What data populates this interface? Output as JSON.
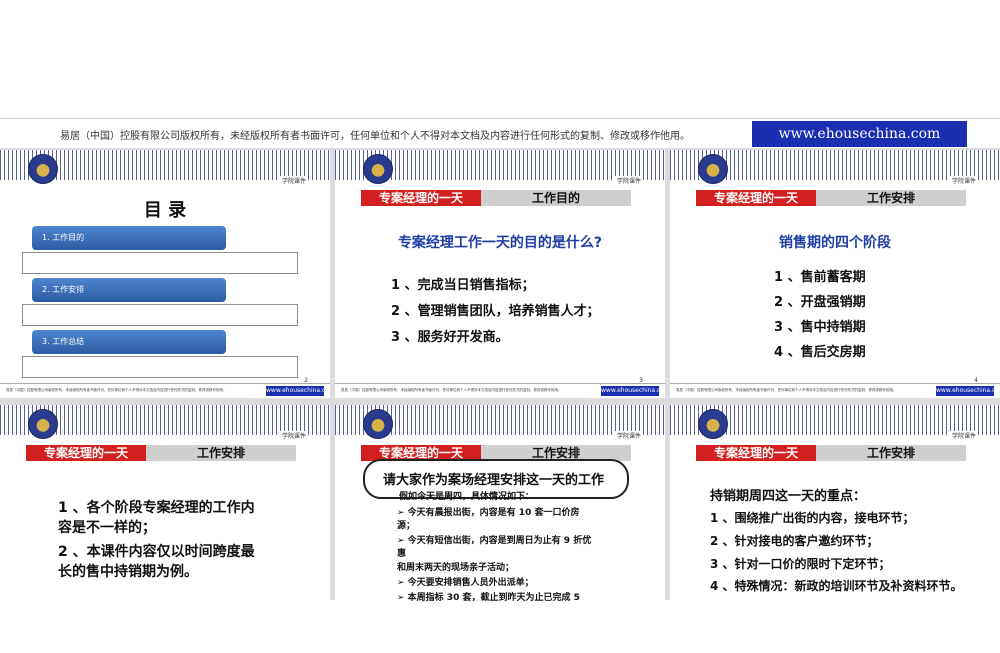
{
  "banner": {
    "text": "易居（中国）控股有限公司版权所有，未经版权所有者书面许可，任何单位和个人不得对本文档及内容进行任何形式的复制、修改或移作他用。",
    "logo": "www.ehousechina.com"
  },
  "common": {
    "course_label": "学院课件",
    "footer_text": "易居（中国）控股有限公司版权所有，未经版权所有者书面许可，任何单位和个人不得对本文档及内容进行任何形式的复制、修改或移作他用。",
    "footer_logo": "www.ehousechina.com",
    "tab_left": "专案经理的一天"
  },
  "slides": {
    "s1": {
      "title": "目 录",
      "items": [
        "1.  工作目的",
        "2.  工作安排",
        "3.  工作总结"
      ],
      "page": "2"
    },
    "s2": {
      "tab_right": "工作目的",
      "heading": "专案经理工作一天的目的是什么?",
      "lines": [
        "1 、完成当日销售指标；",
        "2 、管理销售团队，培养销售人才；",
        "3 、服务好开发商。"
      ],
      "page": "3"
    },
    "s3": {
      "tab_right": "工作安排",
      "heading": "销售期的四个阶段",
      "lines": [
        "1 、售前蓄客期",
        "2 、开盘强销期",
        "3 、售中持销期",
        "4 、售后交房期"
      ],
      "page": "4"
    },
    "s4": {
      "tab_right": "工作安排",
      "lines": [
        "1 、各个阶段专案经理的工作内",
        "容是不一样的；",
        "2 、本课件内容仅以时间跨度最",
        "长的售中持销期为例。"
      ]
    },
    "s5": {
      "tab_right": "工作安排",
      "oval": "请大家作为案场经理安排这一天的工作",
      "intro": "假如今天是周四，具体情况如下：",
      "bullets": [
        "➢   今天有晨报出街，内容是有 10 套一口价房",
        "源；",
        "➢   今天有短信出街，内容是到周日为止有 9 折优",
        "惠",
        "      和周末两天的现场亲子活动；",
        "➢   今天要安排销售人员外出派单；",
        "➢   本周指标 30 套，截止到昨天为止已完成 5"
      ]
    },
    "s6": {
      "tab_right": "工作安排",
      "heading": "持销期周四这一天的重点：",
      "lines": [
        "1 、围绕推广出街的内容，接电环节；",
        "2 、针对接电的客户邀约环节；",
        "3 、针对一口价的限时下定环节；",
        "4 、特殊情况：新政的培训环节及补资料环节。"
      ]
    }
  }
}
